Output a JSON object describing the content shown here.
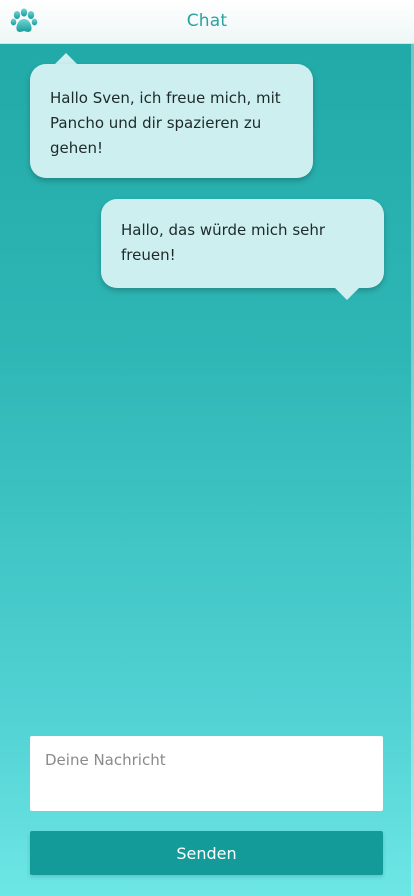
{
  "header": {
    "title": "Chat",
    "logo_icon": "paw-icon"
  },
  "messages": [
    {
      "side": "left",
      "text": "Hallo Sven, ich freue mich, mit Pancho und dir spazieren zu gehen!"
    },
    {
      "side": "right",
      "text": "Hallo, das würde mich sehr freuen!"
    }
  ],
  "composer": {
    "placeholder": "Deine Nachricht",
    "value": "",
    "send_label": "Senden"
  },
  "colors": {
    "accent": "#2aa3a1",
    "button": "#139b9a",
    "bubble": "#cdeff0"
  }
}
